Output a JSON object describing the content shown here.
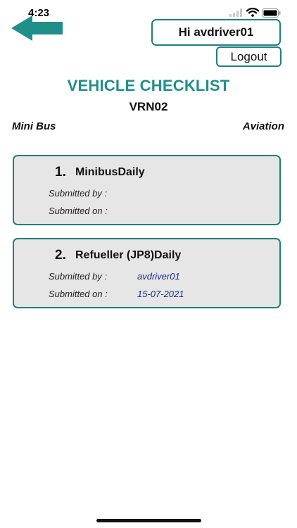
{
  "status_bar": {
    "time": "4:23"
  },
  "header": {
    "back_icon": "left-arrow-icon",
    "greeting": "Hi avdriver01",
    "logout_label": "Logout"
  },
  "page": {
    "title": "VEHICLE CHECKLIST",
    "vehicle_reg": "VRN02",
    "vehicle_type": "Mini Bus",
    "department": "Aviation"
  },
  "checklists": [
    {
      "number": "1.",
      "name": "MinibusDaily",
      "submitted_by_label": "Submitted by :",
      "submitted_on_label": "Submitted on :",
      "submitted_by": "",
      "submitted_on": ""
    },
    {
      "number": "2.",
      "name": "Refueller (JP8)Daily",
      "submitted_by_label": "Submitted by :",
      "submitted_on_label": "Submitted on :",
      "submitted_by": "avdriver01",
      "submitted_on": "15-07-2021"
    }
  ],
  "colors": {
    "accent": "#1f7f7c",
    "title": "#1f8f8a",
    "card_bg": "#e6e6e6",
    "value_text": "#1c2a8c"
  }
}
